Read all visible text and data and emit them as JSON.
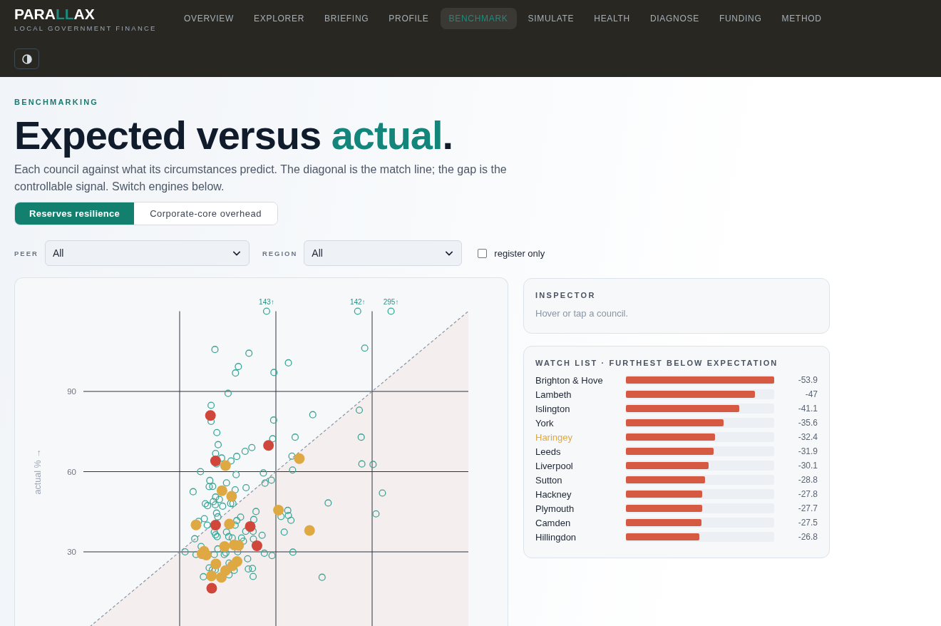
{
  "header": {
    "logo": [
      {
        "text": "PARA",
        "accent": false
      },
      {
        "text": "LL",
        "accent": true
      },
      {
        "text": "AX",
        "accent": false
      }
    ],
    "tagline": "LOCAL GOVERNMENT FINANCE",
    "nav": [
      {
        "label": "OVERVIEW",
        "selected": false
      },
      {
        "label": "EXPLORER",
        "selected": false
      },
      {
        "label": "BRIEFING",
        "selected": false
      },
      {
        "label": "PROFILE",
        "selected": false
      },
      {
        "label": "BENCHMARK",
        "selected": true
      },
      {
        "label": "SIMULATE",
        "selected": false
      },
      {
        "label": "HEALTH",
        "selected": false
      },
      {
        "label": "DIAGNOSE",
        "selected": false
      },
      {
        "label": "FUNDING",
        "selected": false
      },
      {
        "label": "METHOD",
        "selected": false
      }
    ]
  },
  "page": {
    "eyebrow": "BENCHMARKING",
    "title": [
      {
        "text": "Expected versus ",
        "accent": false
      },
      {
        "text": "actual",
        "accent": true
      },
      {
        "text": ".",
        "accent": false
      }
    ],
    "intro": "Each council against what its circumstances predict. The diagonal is the match line; the gap is the controllable signal. Switch engines below.",
    "engines": [
      {
        "label": "Reserves resilience",
        "selected": true
      },
      {
        "label": "Corporate-core overhead",
        "selected": false
      }
    ],
    "filters": {
      "peer": {
        "label": "PEER",
        "value": "All"
      },
      "region": {
        "label": "REGION",
        "value": "All"
      },
      "register_only": {
        "label": "register only",
        "checked": false
      }
    }
  },
  "chart": {
    "overflow_labels": [
      "143↑",
      "142↑",
      "295↑"
    ],
    "ticks": [
      "90",
      "60",
      "30"
    ],
    "axis_label": "actual % →"
  },
  "inspector": {
    "title": "INSPECTOR",
    "hint": "Hover or tap a council."
  },
  "watch_list": {
    "title": "WATCH LIST · FURTHEST BELOW EXPECTATION",
    "rows": [
      {
        "name": "Brighton & Hove",
        "highlighted": false,
        "level": 1.0,
        "value": "-53.9"
      },
      {
        "name": "Lambeth",
        "highlighted": false,
        "level": 0.872,
        "value": "-47"
      },
      {
        "name": "Islington",
        "highlighted": false,
        "level": 0.763,
        "value": "-41.1"
      },
      {
        "name": "York",
        "highlighted": false,
        "level": 0.66,
        "value": "-35.6"
      },
      {
        "name": "Haringey",
        "highlighted": true,
        "level": 0.601,
        "value": "-32.4"
      },
      {
        "name": "Leeds",
        "highlighted": false,
        "level": 0.592,
        "value": "-31.9"
      },
      {
        "name": "Liverpool",
        "highlighted": false,
        "level": 0.558,
        "value": "-30.1"
      },
      {
        "name": "Sutton",
        "highlighted": false,
        "level": 0.534,
        "value": "-28.8"
      },
      {
        "name": "Hackney",
        "highlighted": false,
        "level": 0.516,
        "value": "-27.8"
      },
      {
        "name": "Plymouth",
        "highlighted": false,
        "level": 0.514,
        "value": "-27.7"
      },
      {
        "name": "Camden",
        "highlighted": false,
        "level": 0.51,
        "value": "-27.5"
      },
      {
        "name": "Hillingdon",
        "highlighted": false,
        "level": 0.497,
        "value": "-26.8"
      }
    ]
  }
}
